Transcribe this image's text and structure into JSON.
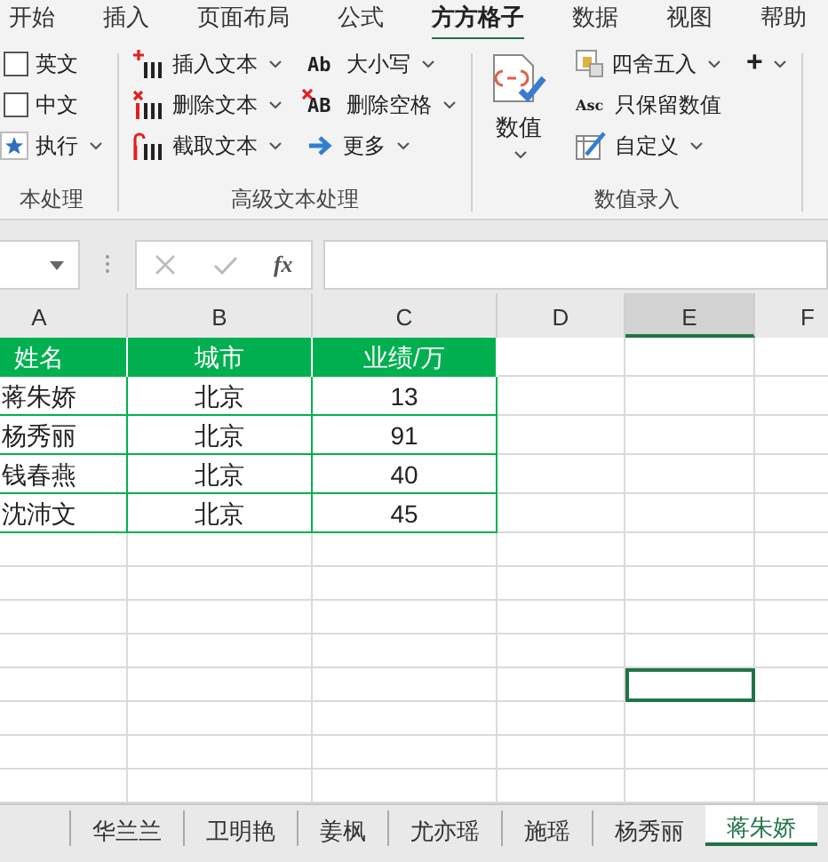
{
  "menu_tabs": [
    {
      "label": "开始",
      "selected": false
    },
    {
      "label": "插入",
      "selected": false
    },
    {
      "label": "页面布局",
      "selected": false
    },
    {
      "label": "公式",
      "selected": false
    },
    {
      "label": "方方格子",
      "selected": true
    },
    {
      "label": "数据",
      "selected": false
    },
    {
      "label": "视图",
      "selected": false
    },
    {
      "label": "帮助",
      "selected": false
    }
  ],
  "ribbon_groups": [
    {
      "label": "本处理",
      "items": [
        {
          "kind": "checkbox",
          "label": "英文",
          "checked": false
        },
        {
          "kind": "checkbox",
          "label": "中文",
          "checked": false
        },
        {
          "kind": "button",
          "label": "执行",
          "dropdown": true
        }
      ]
    },
    {
      "label": "高级文本处理",
      "items": [
        {
          "kind": "button",
          "label": "插入文本",
          "dropdown": true
        },
        {
          "kind": "button",
          "label": "删除文本",
          "dropdown": true
        },
        {
          "kind": "button",
          "label": "截取文本",
          "dropdown": true
        },
        {
          "kind": "button",
          "label": "大小写",
          "icon_text": "Ab",
          "dropdown": true
        },
        {
          "kind": "button",
          "label": "删除空格",
          "icon_text": "AB",
          "dropdown": true
        },
        {
          "kind": "button",
          "label": "更多",
          "dropdown": true
        }
      ]
    },
    {
      "label": "数值录入",
      "items": [
        {
          "kind": "large",
          "label": "数值",
          "dropdown": true
        },
        {
          "kind": "button",
          "label": "四舍五入",
          "dropdown": true
        },
        {
          "kind": "button",
          "label": "只保留数值",
          "icon_text": "Asc",
          "dropdown": false
        },
        {
          "kind": "button",
          "label": "自定义",
          "dropdown": true
        },
        {
          "kind": "button",
          "label": "+",
          "dropdown": true
        }
      ]
    }
  ],
  "formula_bar": {
    "fx_label": "fx"
  },
  "columns": [
    {
      "label": "A",
      "selected": false
    },
    {
      "label": "B",
      "selected": false
    },
    {
      "label": "C",
      "selected": false
    },
    {
      "label": "D",
      "selected": false
    },
    {
      "label": "E",
      "selected": true
    },
    {
      "label": "F",
      "selected": false
    }
  ],
  "table_header": [
    "姓名",
    "城市",
    "业绩/万"
  ],
  "rows": [
    [
      "蒋朱娇",
      "北京",
      "13"
    ],
    [
      "杨秀丽",
      "北京",
      "91"
    ],
    [
      "钱春燕",
      "北京",
      "40"
    ],
    [
      "沈沛文",
      "北京",
      "45"
    ]
  ],
  "sheet_tabs": [
    {
      "label": "华兰兰",
      "selected": false
    },
    {
      "label": "卫明艳",
      "selected": false
    },
    {
      "label": "姜枫",
      "selected": false
    },
    {
      "label": "尤亦瑶",
      "selected": false
    },
    {
      "label": "施瑶",
      "selected": false
    },
    {
      "label": "杨秀丽",
      "selected": false
    },
    {
      "label": "蒋朱娇",
      "selected": true
    }
  ]
}
